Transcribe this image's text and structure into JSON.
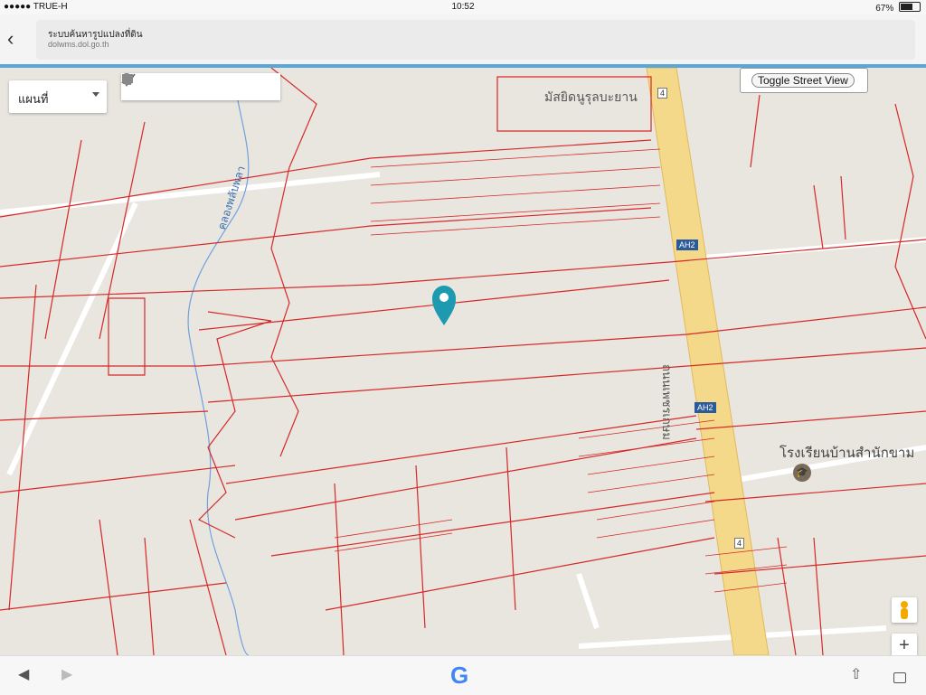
{
  "status_bar": {
    "carrier": "●●●●● TRUE-H",
    "time": "10:52",
    "battery": "67%"
  },
  "browser": {
    "page_title": "ระบบค้นหารูปแปลงที่ดิน",
    "host": "dolwms.dol.go.th"
  },
  "map": {
    "map_type_label": "แผนที่",
    "street_view_label": "Toggle Street View",
    "school_label": "โรงเรียนบ้านสำนักขาม",
    "poi_label": "มัสยิดนูรุลบะยาน",
    "canal_label": "คลองพลับพลา",
    "road_label": "ถนนเพชรเกษม",
    "shields": [
      {
        "text": "4",
        "type": "route"
      },
      {
        "text": "AH2",
        "type": "asian"
      },
      {
        "text": "AH2",
        "type": "asian"
      },
      {
        "text": "4",
        "type": "route"
      }
    ],
    "draw_tools": [
      "hand-icon",
      "marker-icon",
      "polyline-icon",
      "rectangle-icon",
      "circle-icon",
      "polygon-icon"
    ],
    "zoom_in": "+"
  },
  "bottom_bar": {
    "google_logo": "G"
  }
}
